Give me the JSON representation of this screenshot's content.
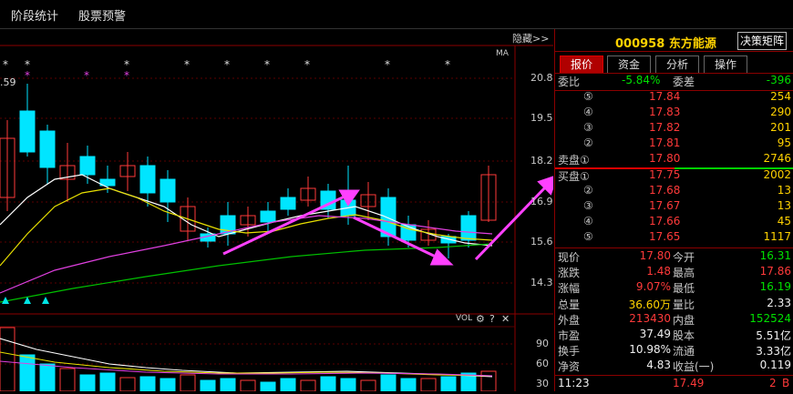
{
  "toolbar": {
    "items": [
      "阶段统计",
      "股票预警"
    ]
  },
  "chart": {
    "hide_label": "隐藏>>",
    "ma_label": "MA",
    "price_ticks": [
      "20.8",
      "19.5",
      "18.2",
      "16.9",
      "15.6",
      "14.3"
    ],
    "price_marker": ".59",
    "vol_label": "VOL",
    "vol_ticks": [
      "90",
      "60",
      "30"
    ],
    "colors": {
      "up": "#ff3a3a",
      "down": "#00e5ff",
      "ma_white": "#ffffff",
      "ma_yellow": "#e8e000",
      "ma_magenta": "#e040e0",
      "ma_green": "#00c000",
      "arrow": "#ff40ff"
    }
  },
  "stock": {
    "code": "000958",
    "name": "东方能源",
    "decision_button": "决策矩阵"
  },
  "tabs": [
    "报价",
    "资金",
    "分析",
    "操作"
  ],
  "weibi": {
    "label1": "委比",
    "value1": "-5.84%",
    "label2": "委差",
    "value2": "-396"
  },
  "sell": [
    {
      "num": "⑤",
      "price": "17.84",
      "vol": "254"
    },
    {
      "num": "④",
      "price": "17.83",
      "vol": "290"
    },
    {
      "num": "③",
      "price": "17.82",
      "vol": "201"
    },
    {
      "num": "②",
      "price": "17.81",
      "vol": "95"
    },
    {
      "num": "卖盘①",
      "price": "17.80",
      "vol": "2746"
    }
  ],
  "buy": [
    {
      "num": "买盘①",
      "price": "17.75",
      "vol": "2002"
    },
    {
      "num": "②",
      "price": "17.68",
      "vol": "13"
    },
    {
      "num": "③",
      "price": "17.67",
      "vol": "13"
    },
    {
      "num": "④",
      "price": "17.66",
      "vol": "45"
    },
    {
      "num": "⑤",
      "price": "17.65",
      "vol": "1117"
    }
  ],
  "stats": [
    {
      "l1": "现价",
      "v1": "17.80",
      "c1": "red",
      "l2": "今开",
      "v2": "16.31",
      "c2": "green"
    },
    {
      "l1": "涨跌",
      "v1": "1.48",
      "c1": "red",
      "l2": "最高",
      "v2": "17.86",
      "c2": "red"
    },
    {
      "l1": "涨幅",
      "v1": "9.07%",
      "c1": "red",
      "l2": "最低",
      "v2": "16.19",
      "c2": "green"
    },
    {
      "l1": "总量",
      "v1": "36.60万",
      "c1": "yellow",
      "l2": "量比",
      "v2": "2.33",
      "c2": "white"
    },
    {
      "l1": "外盘",
      "v1": "213430",
      "c1": "red",
      "l2": "内盘",
      "v2": "152524",
      "c2": "green"
    },
    {
      "l1": "市盈",
      "v1": "37.49",
      "c1": "white",
      "l2": "股本",
      "v2": "5.51亿",
      "c2": "white"
    },
    {
      "l1": "换手",
      "v1": "10.98%",
      "c1": "white",
      "l2": "流通",
      "v2": "3.33亿",
      "c2": "white"
    },
    {
      "l1": "净资",
      "v1": "4.83",
      "c1": "white",
      "l2": "收益(一)",
      "v2": "0.119",
      "c2": "white"
    }
  ],
  "tick": {
    "time": "11:23",
    "price": "17.49",
    "vol": "2",
    "dir": "B"
  }
}
